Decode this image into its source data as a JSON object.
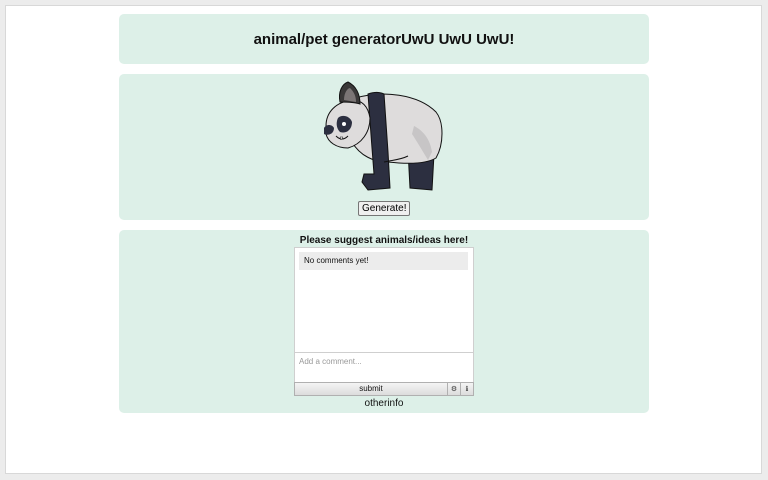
{
  "header": {
    "title": "animal/pet generatorUwU UwU UwU!"
  },
  "generator": {
    "image": {
      "icon": "panda-illustration",
      "alt": "panda"
    },
    "button_label": "Generate!"
  },
  "comments": {
    "heading": "Please suggest animals/ideas here!",
    "empty_message": "No comments yet!",
    "input_placeholder": "Add a comment...",
    "submit_label": "submit",
    "settings_icon": "gear-icon",
    "info_icon": "info-icon",
    "settings_glyph": "⚙",
    "info_glyph": "ℹ"
  },
  "footer": {
    "text": "otherinfo"
  },
  "colors": {
    "panel_bg": "#ddf0e8",
    "panda_black": "#2c2f40",
    "panda_white": "#dedcdc"
  }
}
